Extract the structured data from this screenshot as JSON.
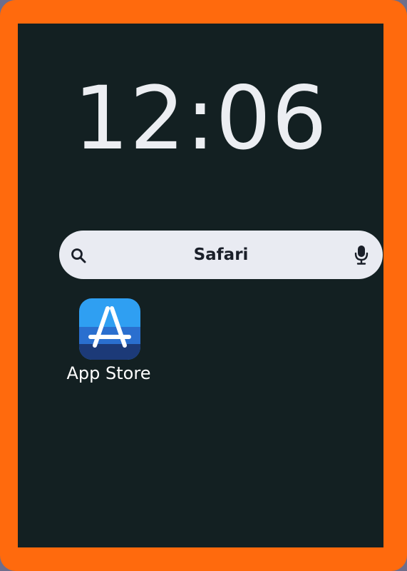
{
  "lock_screen": {
    "time": "12:06"
  },
  "search": {
    "query": "Safari",
    "icon": "search-icon",
    "mic_icon": "microphone-icon"
  },
  "apps": [
    {
      "label": "App Store",
      "icon": "app-store-icon"
    }
  ],
  "colors": {
    "frame": "#ff6a0d",
    "screen_background": "#132022",
    "search_bar": "#e9ebf2",
    "clock_text": "#eceef2",
    "app_store_top": "#2f9ff2",
    "app_store_bottom": "#1c3a78"
  }
}
